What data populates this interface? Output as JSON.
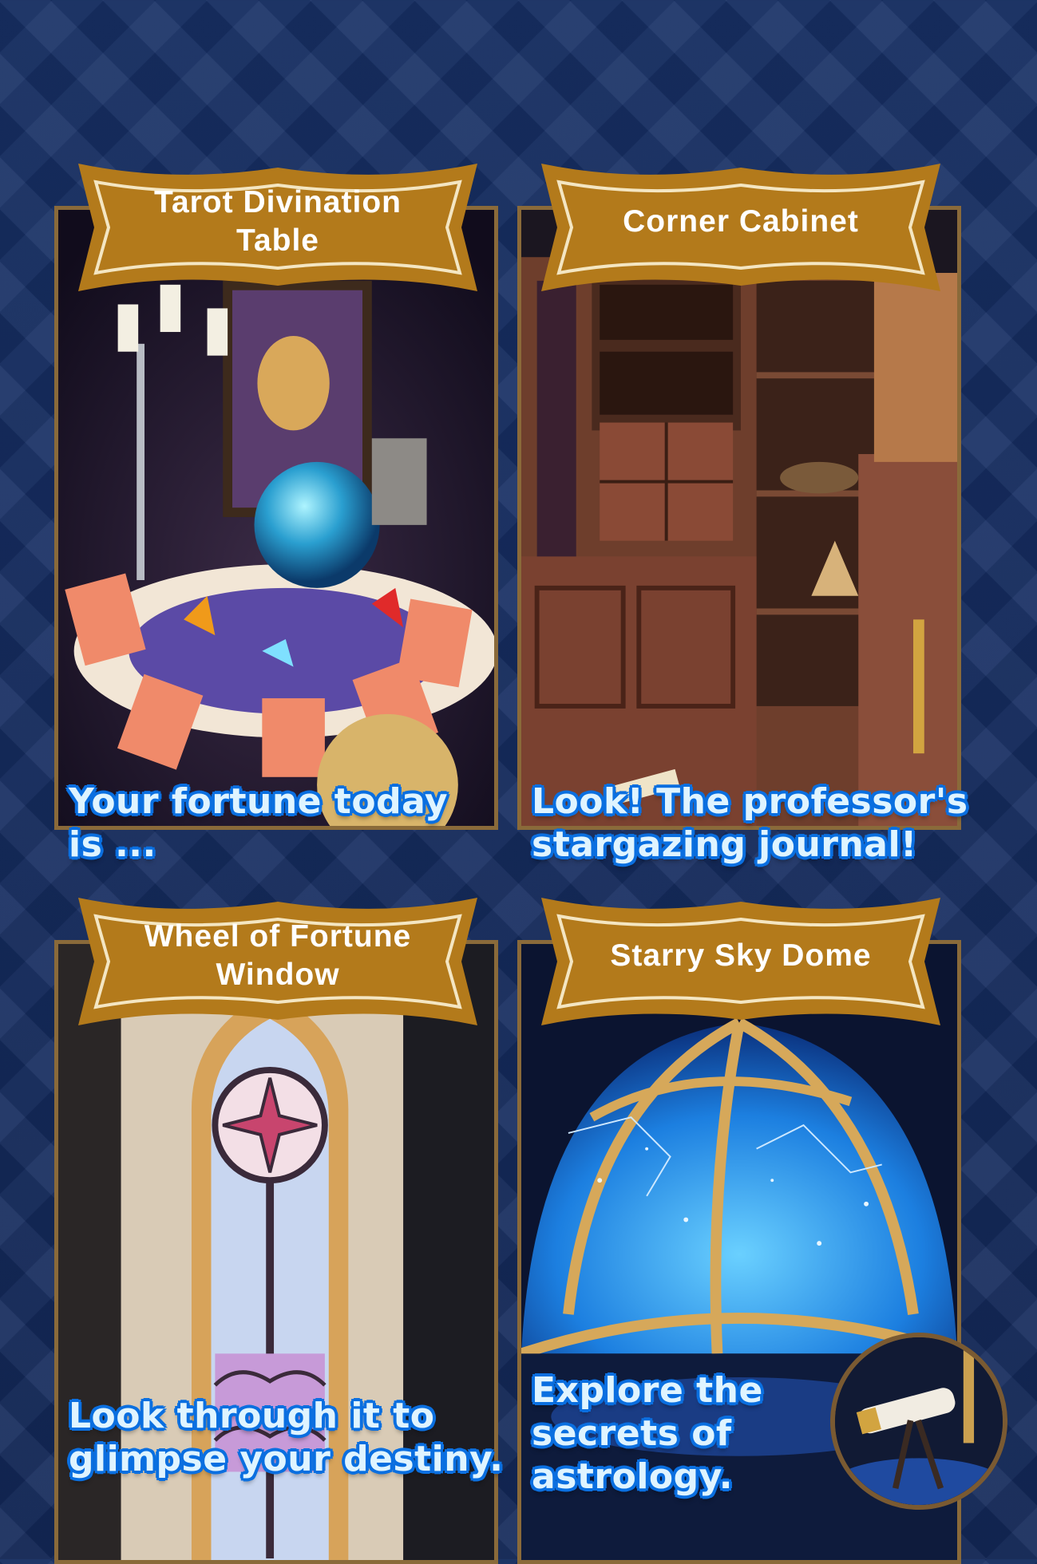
{
  "panels": [
    {
      "title": "Tarot Divination Table",
      "caption": "Your fortune today is ..."
    },
    {
      "title": "Corner Cabinet",
      "caption": "Look! The professor's stargazing journal!"
    },
    {
      "title": "Wheel of Fortune Window",
      "caption": "Look through it to glimpse your destiny."
    },
    {
      "title": "Starry Sky Dome",
      "caption": "Explore the secrets of astrology."
    }
  ],
  "colors": {
    "background": "#152a5c",
    "banner_fill": "#b37a1b",
    "banner_trim": "#f4e6c2",
    "caption_text": "#dff4ff",
    "caption_outline": "#0a6fe0",
    "frame": "#8a6a3a"
  }
}
